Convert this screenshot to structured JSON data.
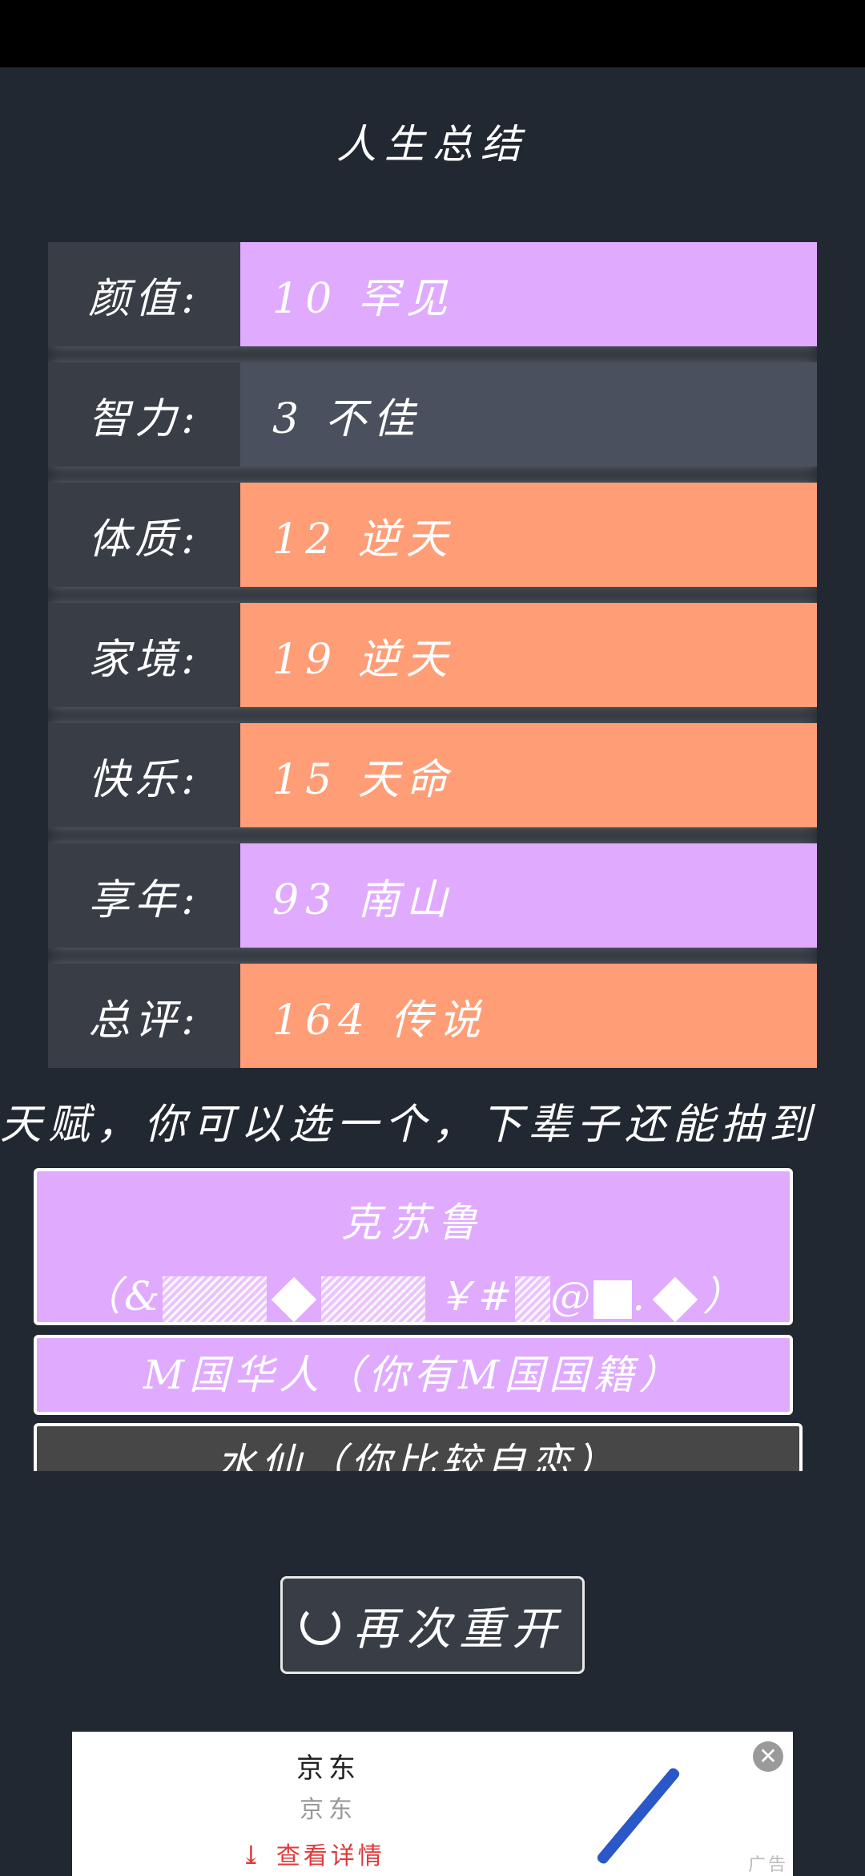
{
  "page": {
    "title": "人生总结"
  },
  "summary": {
    "rows": [
      {
        "label": "颜值:",
        "value": "10 罕见",
        "color": "#e0aaff"
      },
      {
        "label": "智力:",
        "value": "3 不佳",
        "color": "#4a505d"
      },
      {
        "label": "体质:",
        "value": "12 逆天",
        "color": "#ff9d76"
      },
      {
        "label": "家境:",
        "value": "19 逆天",
        "color": "#ff9d76"
      },
      {
        "label": "快乐:",
        "value": "15 天命",
        "color": "#ff9d76"
      },
      {
        "label": "享年:",
        "value": "93 南山",
        "color": "#e0aaff"
      },
      {
        "label": "总评:",
        "value": "164 传说",
        "color": "#ff9d76"
      }
    ]
  },
  "talents": {
    "heading": "天赋，你可以选一个，下辈子还能抽到",
    "items": [
      {
        "name": "克苏鲁",
        "desc_prefix": "（&",
        "desc_mid": "￥#",
        "desc_tail1": "@",
        "desc_tail2": ".",
        "desc_suffix": "）"
      },
      {
        "label": "M国华人（你有M国国籍）"
      },
      {
        "label": "水仙（你比较自恋）"
      }
    ]
  },
  "actions": {
    "restart_label": "再次重开"
  },
  "ad": {
    "title": "京东",
    "subtitle": "京东",
    "cta": "查看详情",
    "tag": "广告"
  },
  "colors": {
    "background": "#222831",
    "label_bg": "#393e46",
    "purple": "#e0aaff",
    "orange": "#ff9d76"
  }
}
